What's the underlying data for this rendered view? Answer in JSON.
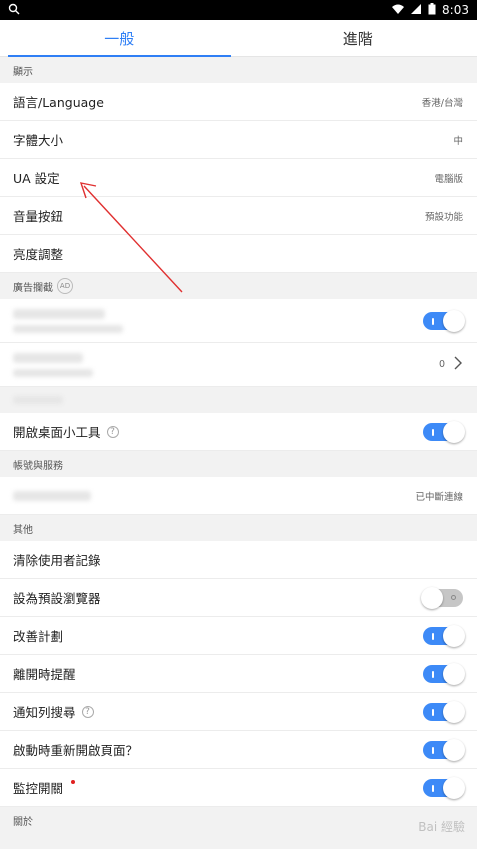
{
  "status": {
    "time": "8:03"
  },
  "tabs": [
    {
      "label": "一般"
    },
    {
      "label": "進階"
    }
  ],
  "sections": {
    "display": "顯示",
    "ad_block": "廣告攔截",
    "ad_badge": "AD",
    "account": "帳號與服務",
    "other": "其他",
    "about": "關於"
  },
  "display_rows": [
    {
      "label": "語言/Language",
      "value": "香港/台灣"
    },
    {
      "label": "字體大小",
      "value": "中"
    },
    {
      "label": "UA 設定",
      "value": "電腦版"
    },
    {
      "label": "音量按鈕",
      "value": "預設功能"
    },
    {
      "label": "亮度調整",
      "value": ""
    }
  ],
  "ad_rows": [
    {
      "count": "0"
    }
  ],
  "widget": {
    "label": "開啟桌面小工具",
    "help": "?"
  },
  "account_row": {
    "value": "已中斷連線"
  },
  "other_rows": [
    {
      "label": "清除使用者記錄"
    },
    {
      "label": "設為預設瀏覽器",
      "toggle": "off"
    },
    {
      "label": "改善計劃",
      "toggle": "on"
    },
    {
      "label": "離開時提醒",
      "toggle": "on"
    },
    {
      "label": "通知列搜尋",
      "toggle": "on",
      "help": "?"
    },
    {
      "label": "啟動時重新開啟頁面？",
      "toggle": "on"
    },
    {
      "label": "監控開關",
      "toggle": "on"
    }
  ],
  "watermark": "Bai 經驗",
  "colors": {
    "accent": "#2f7ff5",
    "annotation": "#e03030"
  }
}
